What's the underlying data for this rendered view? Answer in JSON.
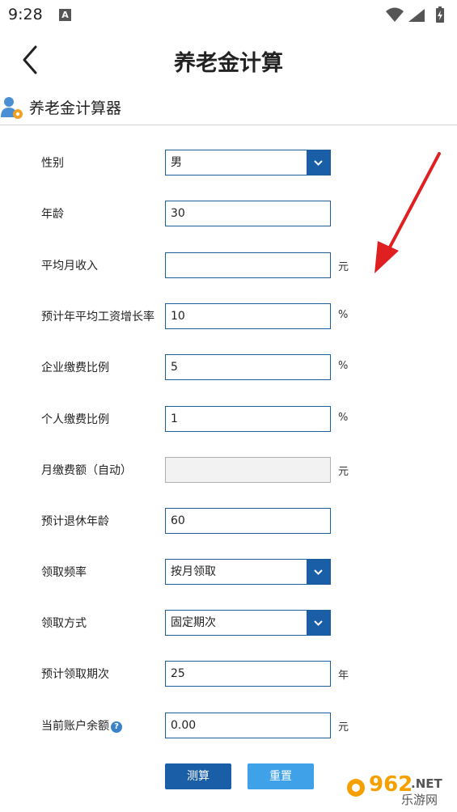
{
  "status_bar": {
    "time": "9:28",
    "notification_badge": "A"
  },
  "app_bar": {
    "title": "养老金计算",
    "back_icon": "chevron-left-icon"
  },
  "section": {
    "title": "养老金计算器",
    "icon": "user-gear-icon"
  },
  "form": {
    "gender": {
      "label": "性别",
      "value": "男"
    },
    "age": {
      "label": "年龄",
      "value": "30"
    },
    "avg_monthly_income": {
      "label": "平均月收入",
      "value": "",
      "unit": "元"
    },
    "wage_growth_rate": {
      "label": "预计年平均工资增长率",
      "value": "10",
      "unit": "%"
    },
    "company_contribution_rate": {
      "label": "企业缴费比例",
      "value": "5",
      "unit": "%"
    },
    "personal_contribution_rate": {
      "label": "个人缴费比例",
      "value": "1",
      "unit": "%"
    },
    "monthly_contribution": {
      "label": "月缴费额（自动）",
      "value": "",
      "unit": "元"
    },
    "retirement_age": {
      "label": "预计退休年龄",
      "value": "60"
    },
    "claim_frequency": {
      "label": "领取频率",
      "value": "按月领取"
    },
    "claim_method": {
      "label": "领取方式",
      "value": "固定期次"
    },
    "claim_periods": {
      "label": "预计领取期次",
      "value": "25",
      "unit": "年"
    },
    "account_balance": {
      "label": "当前账户余额",
      "value": "0.00",
      "unit": "元",
      "help_icon": "?"
    }
  },
  "buttons": {
    "calculate": "测算",
    "reset": "重置"
  },
  "watermark": {
    "number": "962",
    "suffix": ".NET",
    "name": "乐游网"
  },
  "colors": {
    "primary": "#1a5ea8",
    "secondary": "#3fa1e7",
    "annotation_arrow": "#e02020"
  }
}
